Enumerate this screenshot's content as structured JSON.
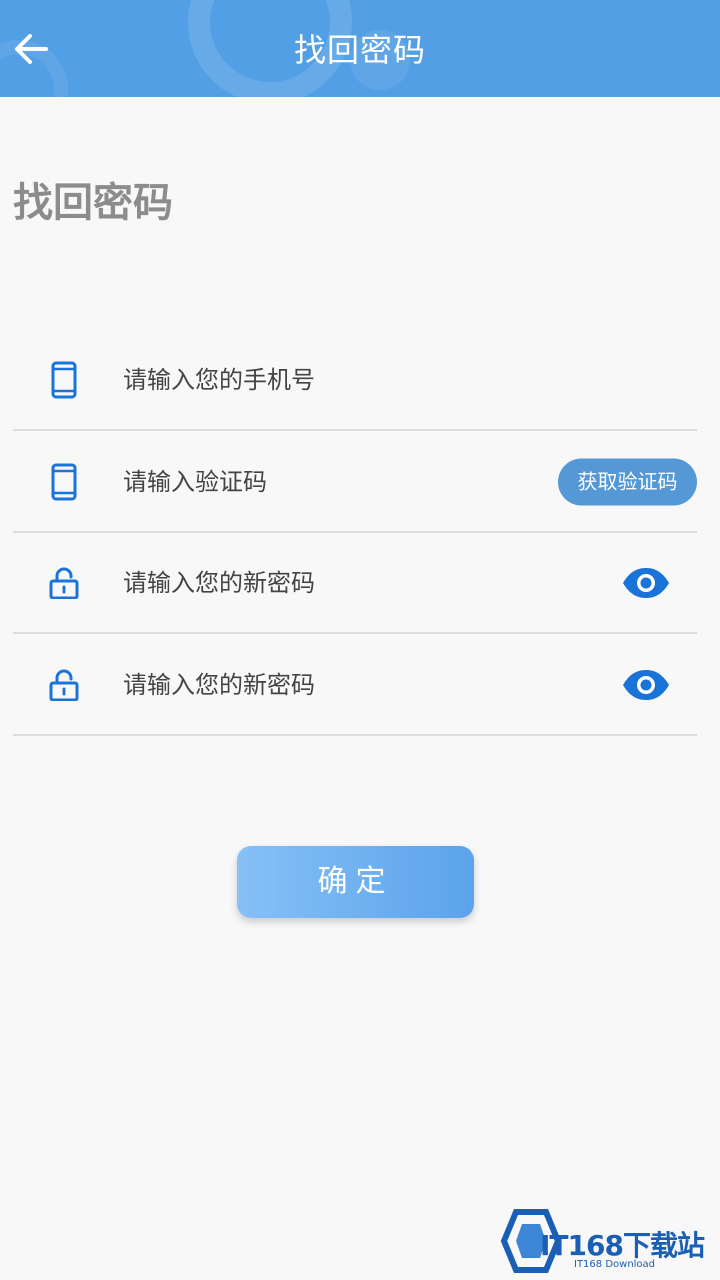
{
  "header": {
    "title": "找回密码",
    "back_icon": "arrow-left-icon",
    "color": "#539fe5"
  },
  "page": {
    "title": "找回密码"
  },
  "form": {
    "phone": {
      "placeholder": "请输入您的手机号",
      "icon": "phone-icon"
    },
    "code": {
      "placeholder": "请输入验证码",
      "icon": "phone-icon",
      "button_label": "获取验证码"
    },
    "password": {
      "placeholder": "请输入您的新密码",
      "icon": "lock-icon",
      "toggle_icon": "eye-icon"
    },
    "confirm_password": {
      "placeholder": "请输入您的新密码",
      "icon": "lock-icon",
      "toggle_icon": "eye-icon"
    },
    "accent_color": "#1a73d9"
  },
  "confirm_button": {
    "label": "确定"
  },
  "watermark": {
    "main": "IT168下载站",
    "sub": "IT168 Download"
  }
}
